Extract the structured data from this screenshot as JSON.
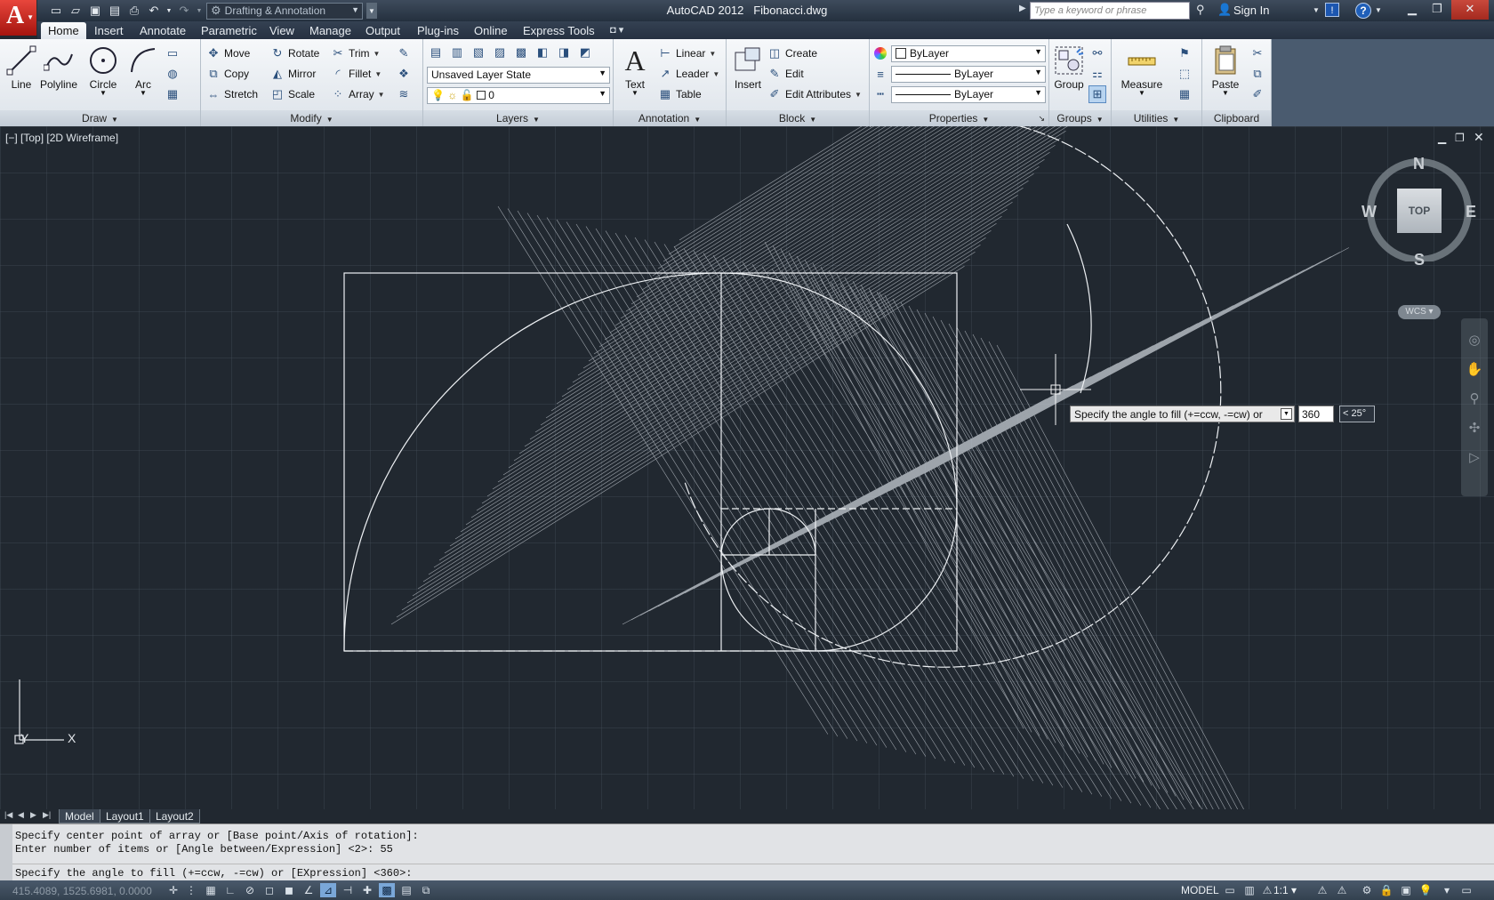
{
  "app": {
    "title": "AutoCAD 2012   Fibonacci.dwg",
    "workspace": "Drafting & Annotation",
    "search_placeholder": "Type a keyword or phrase",
    "sign_in": "Sign In"
  },
  "tabs": [
    "Home",
    "Insert",
    "Annotate",
    "Parametric",
    "View",
    "Manage",
    "Output",
    "Plug-ins",
    "Online",
    "Express Tools"
  ],
  "ribbon": {
    "draw": {
      "title": "Draw",
      "line": "Line",
      "polyline": "Polyline",
      "circle": "Circle",
      "arc": "Arc"
    },
    "modify": {
      "title": "Modify",
      "move": "Move",
      "rotate": "Rotate",
      "trim": "Trim",
      "copy": "Copy",
      "mirror": "Mirror",
      "fillet": "Fillet",
      "stretch": "Stretch",
      "scale": "Scale",
      "array": "Array"
    },
    "layers": {
      "title": "Layers",
      "layer_state": "Unsaved Layer State",
      "current_layer": "0"
    },
    "annotation": {
      "title": "Annotation",
      "text": "Text",
      "linear": "Linear",
      "leader": "Leader",
      "table": "Table"
    },
    "block": {
      "title": "Block",
      "insert": "Insert",
      "create": "Create",
      "edit": "Edit",
      "edit_attributes": "Edit Attributes"
    },
    "properties": {
      "title": "Properties",
      "color": "ByLayer",
      "linetype": "ByLayer",
      "lineweight": "ByLayer"
    },
    "groups": {
      "title": "Groups",
      "group": "Group"
    },
    "utilities": {
      "title": "Utilities",
      "measure": "Measure"
    },
    "clipboard": {
      "title": "Clipboard",
      "paste": "Paste"
    }
  },
  "viewport": {
    "label": "[−] [Top] [2D Wireframe]",
    "viewcube": {
      "top": "TOP",
      "n": "N",
      "s": "S",
      "e": "E",
      "w": "W",
      "wcs": "WCS"
    },
    "tooltip": "Specify the angle to fill (+=ccw, -=cw) or",
    "input_value": "360",
    "angle_readout": "< 25°",
    "ucs_x": "X",
    "ucs_y": "Y"
  },
  "layout_tabs": [
    "Model",
    "Layout1",
    "Layout2"
  ],
  "command_line": {
    "line1": "Specify center point of array or [Base point/Axis of rotation]:",
    "line2": "Enter number of items or [Angle between/Expression] <2>: 55",
    "prompt": "Specify the angle to fill (+=ccw, -=cw) or [EXpression] <360>:"
  },
  "status": {
    "coords": "415.4089, 1525.6981, 0.0000",
    "model": "MODEL",
    "scale": "1:1"
  },
  "colors": {
    "viewport_bg": "#212830",
    "geometry": "#e8ecf0",
    "accent": "#1f5fb9"
  }
}
